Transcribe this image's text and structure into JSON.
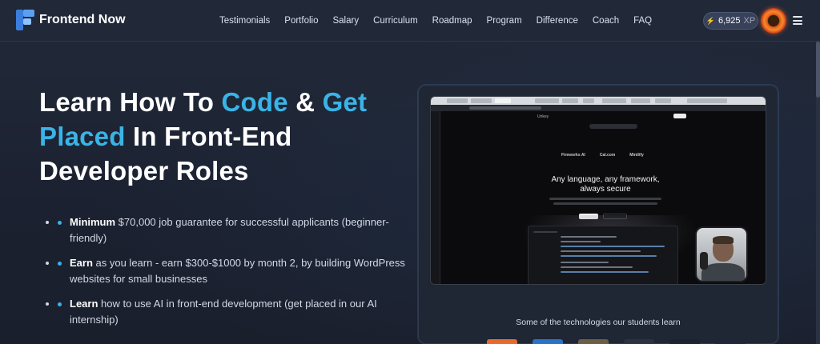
{
  "nav": {
    "brand": "Frontend Now",
    "links": [
      "Testimonials",
      "Portfolio",
      "Salary",
      "Curriculum",
      "Roadmap",
      "Program",
      "Difference",
      "Coach",
      "FAQ"
    ],
    "xp_icon": "⚡",
    "xp_value": "6,925",
    "xp_unit": "XP"
  },
  "hero": {
    "title_parts": [
      "Learn How To ",
      "Code",
      " & ",
      "Get Placed",
      " In Front-End Developer Roles"
    ],
    "accent_color": "#3ab4e6",
    "bullets": [
      {
        "strong": "Minimum",
        "text": " $70,000 job guarantee for successful applicants (beginner-friendly)"
      },
      {
        "strong": "Earn",
        "text": " as you learn - earn $300-$1000 by month 2, by building WordPress websites for small businesses"
      },
      {
        "strong": "Learn",
        "text": " how to use AI in front-end development (get placed in our AI internship)"
      }
    ]
  },
  "video": {
    "brand": "Unkey",
    "logos": [
      "Fireworks AI",
      "Cal.com",
      "Mintlify"
    ],
    "headline": "Any language, any framework, always secure"
  },
  "tech": {
    "caption": "Some of the technologies our students learn",
    "logo_colors": [
      "#e8692c",
      "#2a72c8",
      "#6b5e45",
      "#2b3340",
      "#1c2230",
      "#20263a"
    ]
  }
}
